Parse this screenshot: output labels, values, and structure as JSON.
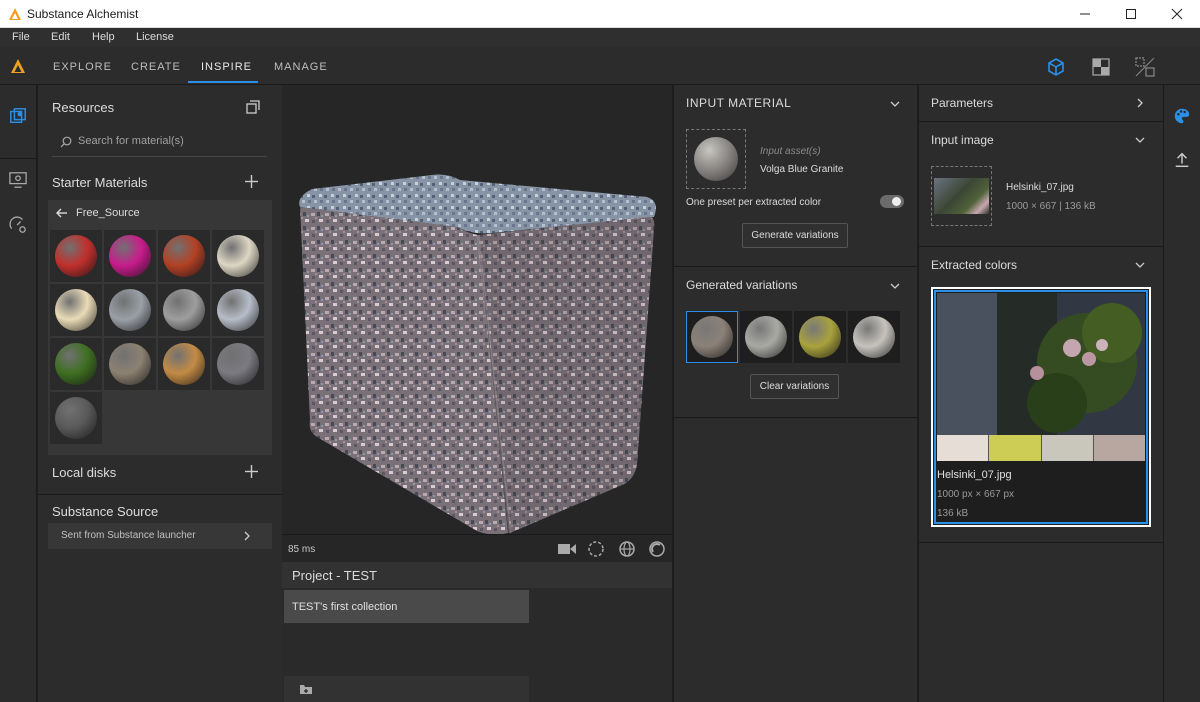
{
  "window": {
    "title": "Substance Alchemist"
  },
  "menu": [
    "File",
    "Edit",
    "Help",
    "License"
  ],
  "tabs": [
    "EXPLORE",
    "CREATE",
    "INSPIRE",
    "MANAGE"
  ],
  "resources": {
    "title": "Resources",
    "search_placeholder": "Search for material(s)",
    "starter_title": "Starter Materials",
    "folder": "Free_Source",
    "local_disks": "Local disks",
    "substance_source": "Substance Source",
    "source_link": "Sent from Substance launcher"
  },
  "materials": [
    {
      "name": "red-plastic",
      "color": "#c0302c"
    },
    {
      "name": "pink-metal",
      "color": "#c81c8c"
    },
    {
      "name": "orange-rough",
      "color": "#b34125"
    },
    {
      "name": "cream-plaster",
      "color": "#ddd6c4"
    },
    {
      "name": "cream-tiles",
      "color": "#e9dbb7"
    },
    {
      "name": "silver-cylinder",
      "color": "#9aa0a8"
    },
    {
      "name": "diamond-plate",
      "color": "#9e9e9e"
    },
    {
      "name": "blue-granite",
      "color": "#b6bdc8"
    },
    {
      "name": "green-moss",
      "color": "#3f6f22"
    },
    {
      "name": "stone-brick",
      "color": "#8c8172"
    },
    {
      "name": "sand",
      "color": "#c38b45"
    },
    {
      "name": "grey-granite",
      "color": "#7a7a80"
    },
    {
      "name": "dark-tiles",
      "color": "#5a5a5a"
    }
  ],
  "viewport": {
    "render_time": "85 ms"
  },
  "project": {
    "title": "Project - TEST",
    "collection": "TEST's first collection"
  },
  "input_material": {
    "title": "INPUT MATERIAL",
    "asset_label": "Input asset(s)",
    "asset_name": "Volga Blue Granite",
    "toggle_label": "One preset per extracted color",
    "generate_button": "Generate variations"
  },
  "variations": {
    "title": "Generated variations",
    "clear_button": "Clear variations",
    "swatches": [
      "#8b8178",
      "#a9a9a4",
      "#a9a23d",
      "#c6c3bd"
    ]
  },
  "parameters": {
    "title": "Parameters",
    "input_image_title": "Input image",
    "file_name": "Helsinki_07.jpg",
    "file_meta": "1000 × 667 | 136 kB",
    "extracted_title": "Extracted colors",
    "colors": [
      "#e6ded6",
      "#cdcc55",
      "#c9c6bb",
      "#b8a6a1"
    ],
    "detail_name": "Helsinki_07.jpg",
    "detail_size": "1000 px × 667 px",
    "detail_kb": "136 kB"
  }
}
